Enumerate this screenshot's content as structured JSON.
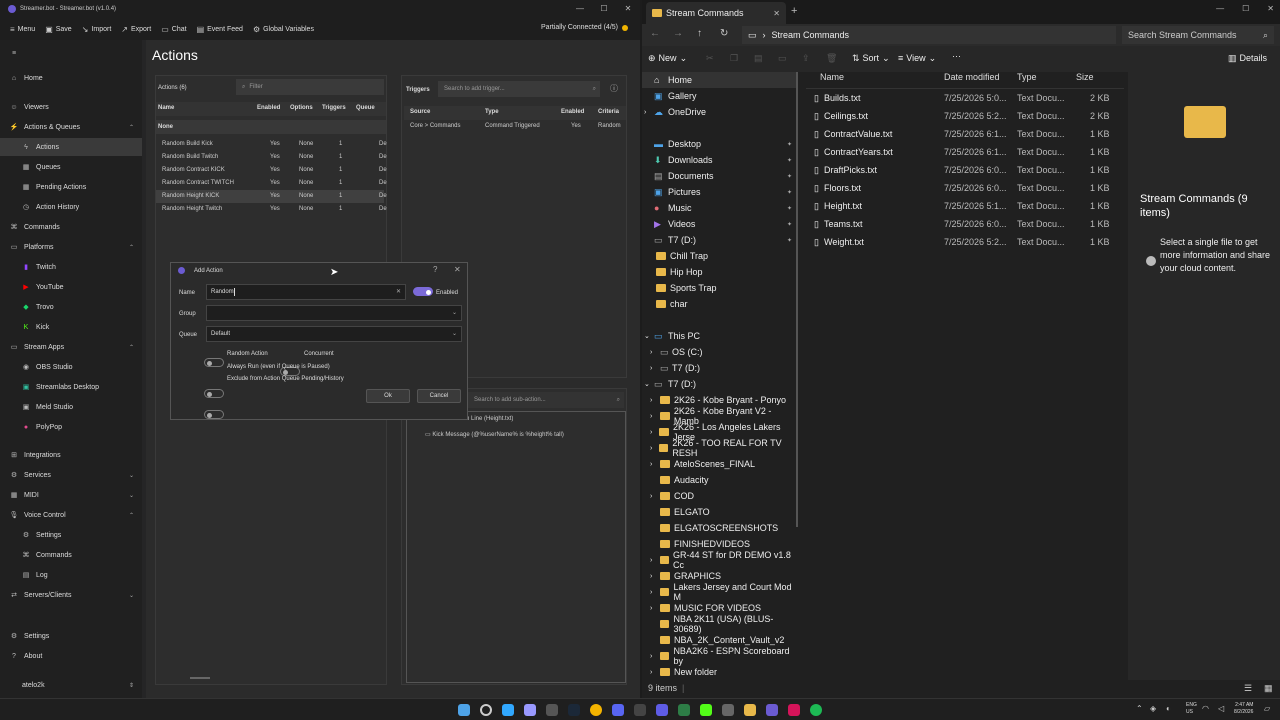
{
  "streamerbot": {
    "window_title": "Streamer.bot - Streamer.bot (v1.0.4)",
    "toolbar": {
      "menu": "Menu",
      "save": "Save",
      "import": "Import",
      "export": "Export",
      "chat": "Chat",
      "event_feed": "Event Feed",
      "global_variables": "Global Variables",
      "connection_status": "Partially Connected (4/5)"
    },
    "sidebar": {
      "home": "Home",
      "viewers": "Viewers",
      "actions_queues": "Actions & Queues",
      "actions": "Actions",
      "queues": "Queues",
      "pending_actions": "Pending Actions",
      "action_history": "Action History",
      "commands": "Commands",
      "platforms": "Platforms",
      "twitch": "Twitch",
      "youtube": "YouTube",
      "trovo": "Trovo",
      "kick": "Kick",
      "stream_apps": "Stream Apps",
      "obs_studio": "OBS Studio",
      "streamlabs_desktop": "Streamlabs Desktop",
      "meld_studio": "Meld Studio",
      "polypop": "PolyPop",
      "integrations": "Integrations",
      "services": "Services",
      "midi": "MIDI",
      "voice_control": "Voice Control",
      "vc_settings": "Settings",
      "vc_commands": "Commands",
      "vc_log": "Log",
      "servers_clients": "Servers/Clients",
      "settings": "Settings",
      "about": "About",
      "user": "atelo2k"
    },
    "heading": "Actions",
    "actions_panel": {
      "title": "Actions (6)",
      "filter_placeholder": "Filter",
      "columns": [
        "Name",
        "Enabled",
        "Options",
        "Triggers",
        "Queue"
      ],
      "group": "None",
      "rows": [
        [
          "Random Build Kick",
          "Yes",
          "None",
          "1",
          "De"
        ],
        [
          "Random Build Twitch",
          "Yes",
          "None",
          "1",
          "De"
        ],
        [
          "Random Contract KICK",
          "Yes",
          "None",
          "1",
          "De"
        ],
        [
          "Random Contract TWITCH",
          "Yes",
          "None",
          "1",
          "De"
        ],
        [
          "Random Height KICK",
          "Yes",
          "None",
          "1",
          "De"
        ],
        [
          "Random Height Twitch",
          "Yes",
          "None",
          "1",
          "De"
        ]
      ]
    },
    "triggers_panel": {
      "title": "Triggers",
      "search_placeholder": "Search to add trigger...",
      "columns": [
        "Source",
        "Type",
        "Enabled",
        "Criteria"
      ],
      "row": [
        "Core > Commands",
        "Command Triggered",
        "Yes",
        "Random"
      ]
    },
    "subactions_panel": {
      "search_placeholder": "Search to add sub-action...",
      "items": [
        "Random Line (Height.txt)",
        "Kick Message (@%userName% is %height% tall)"
      ],
      "item0_visible": "om Line (Height.txt)"
    },
    "dialog": {
      "title": "Add Action",
      "name_label": "Name",
      "name_value": "Random ",
      "enabled_label": "Enabled",
      "group_label": "Group",
      "group_value": "",
      "queue_label": "Queue",
      "queue_value": "Default",
      "random_action": "Random Action",
      "concurrent": "Concurrent",
      "always_run": "Always Run (even if Queue is Paused)",
      "exclude": "Exclude from Action Queue Pending/History",
      "ok": "Ok",
      "cancel": "Cancel"
    }
  },
  "explorer": {
    "tab_title": "Stream Commands",
    "breadcrumb": "Stream Commands",
    "search_placeholder": "Search Stream Commands",
    "cmd": {
      "new": "New",
      "sort": "Sort",
      "view": "View",
      "details": "Details"
    },
    "nav": {
      "home": "Home",
      "gallery": "Gallery",
      "onedrive": "OneDrive",
      "pinned": [
        "Desktop",
        "Downloads",
        "Documents",
        "Pictures",
        "Music",
        "Videos",
        "T7 (D:)"
      ],
      "folders": [
        "Chill Trap",
        "Hip Hop",
        "Sports Trap",
        "char"
      ],
      "this_pc": "This PC",
      "os_c": "OS (C:)",
      "t7_d": "T7 (D:)",
      "t7_d_expanded": "T7 (D:)",
      "t7_items": [
        "2K26 - Kobe Bryant - Ponyo",
        "2K26 - Kobe Bryant V2 - Mamb",
        "2K26 - Los Angeles Lakers Jerse",
        "2K26 - TOO REAL FOR TV RESH",
        "AteloScenes_FINAL",
        "Audacity",
        "COD",
        "ELGATO",
        "ELGATOSCREENSHOTS",
        "FINISHEDVIDEOS",
        "GR-44 ST for DR DEMO v1.8 Cc",
        "GRAPHICS",
        "Lakers Jersey and Court Mod M",
        "MUSIC FOR VIDEOS",
        "NBA 2K11 (USA) (BLUS-30689)",
        "NBA_2K_Content_Vault_v2",
        "NBA2K6 - ESPN Scoreboard by",
        "New folder"
      ]
    },
    "columns": [
      "Name",
      "Date modified",
      "Type",
      "Size"
    ],
    "files": [
      [
        "Builds.txt",
        "7/25/2026 5:0...",
        "Text Docu...",
        "2 KB"
      ],
      [
        "Ceilings.txt",
        "7/25/2026 5:2...",
        "Text Docu...",
        "2 KB"
      ],
      [
        "ContractValue.txt",
        "7/25/2026 6:1...",
        "Text Docu...",
        "1 KB"
      ],
      [
        "ContractYears.txt",
        "7/25/2026 6:1...",
        "Text Docu...",
        "1 KB"
      ],
      [
        "DraftPicks.txt",
        "7/25/2026 6:0...",
        "Text Docu...",
        "1 KB"
      ],
      [
        "Floors.txt",
        "7/25/2026 6:0...",
        "Text Docu...",
        "1 KB"
      ],
      [
        "Height.txt",
        "7/25/2026 5:1...",
        "Text Docu...",
        "1 KB"
      ],
      [
        "Teams.txt",
        "7/25/2026 6:0...",
        "Text Docu...",
        "1 KB"
      ],
      [
        "Weight.txt",
        "7/25/2026 5:2...",
        "Text Docu...",
        "1 KB"
      ]
    ],
    "details": {
      "title": "Stream Commands (9 items)",
      "info": "Select a single file to get more information and share your cloud content."
    },
    "status": "9 items"
  },
  "taskbar": {
    "lang1": "ENG",
    "lang2": "US",
    "time": "2:47 AM",
    "date": "8/2/2026"
  },
  "colors": {
    "accent": "#7b6ad8",
    "folder": "#e8b84a",
    "connection": "#f0b400"
  }
}
